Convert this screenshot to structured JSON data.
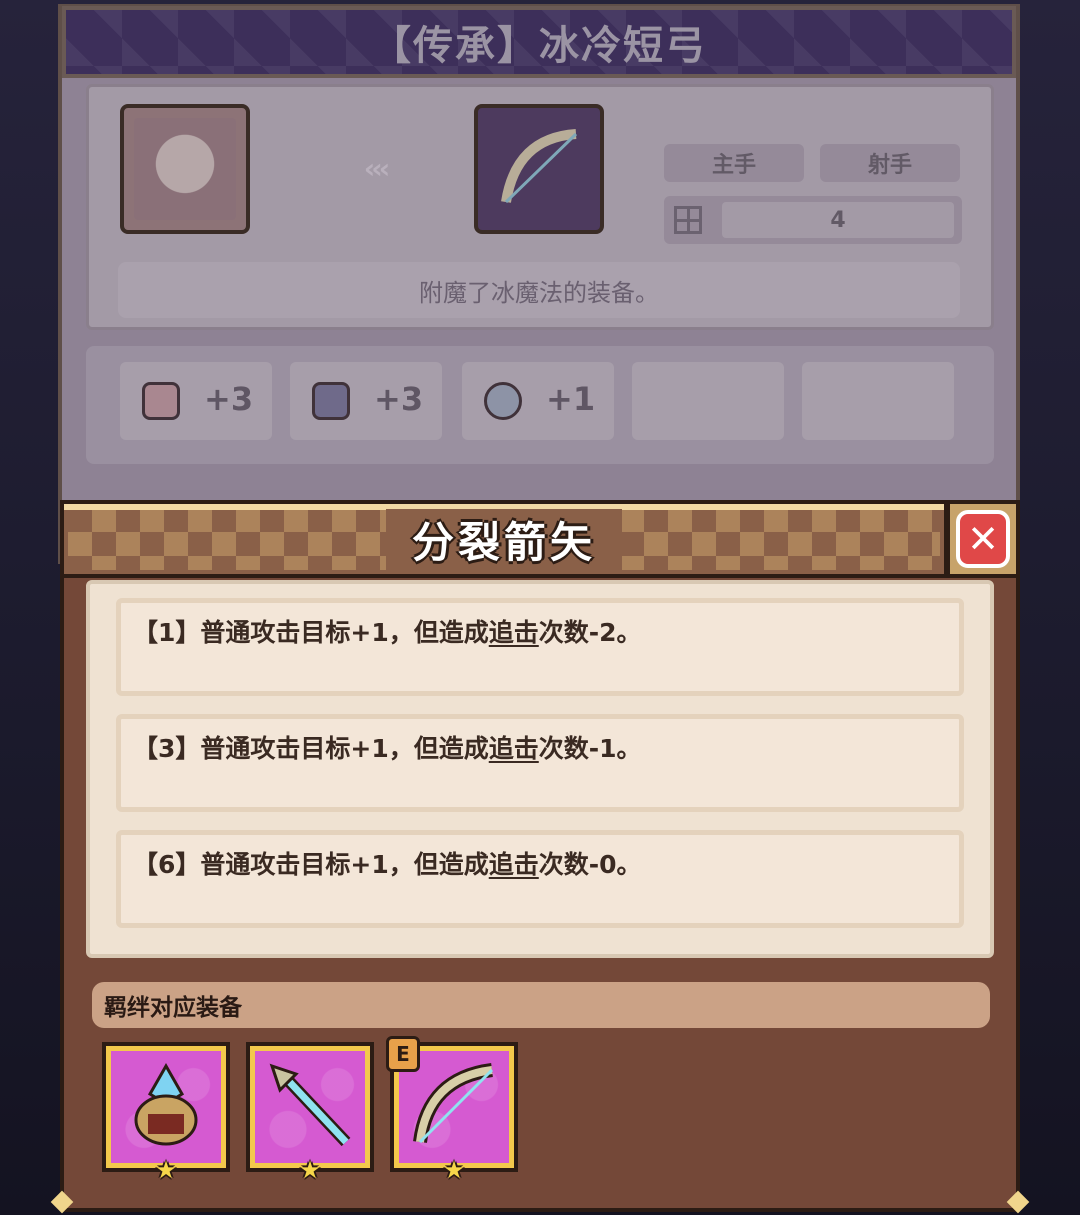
{
  "equipment": {
    "title": "【传承】冰冷短弓",
    "slot_label": "主手",
    "class_label": "射手",
    "slot_count": "4",
    "description": "附魔了冰魔法的装备。",
    "stats": [
      {
        "icon": "pink-crystal-icon",
        "value": "+3"
      },
      {
        "icon": "boot-icon",
        "value": "+3"
      },
      {
        "icon": "silver-ore-icon",
        "value": "+1"
      }
    ]
  },
  "popup": {
    "title": "分裂箭矢",
    "effects": [
      {
        "prefix": "【1】普通攻击目标+1，但造成",
        "link": "追击",
        "suffix": "次数-2。"
      },
      {
        "prefix": "【3】普通攻击目标+1，但造成",
        "link": "追击",
        "suffix": "次数-1。"
      },
      {
        "prefix": "【6】普通攻击目标+1，但造成",
        "link": "追击",
        "suffix": "次数-0。"
      }
    ],
    "bond_label": "羁绊对应装备",
    "bond_items": [
      {
        "icon": "crystal-helmet-icon",
        "stars": "★"
      },
      {
        "icon": "ice-spear-icon",
        "stars": "★"
      },
      {
        "icon": "bow-icon",
        "stars": "★",
        "badge": "E"
      }
    ]
  },
  "colors": {
    "popup_bg": "#744838",
    "panel_bg": "#efe2d2",
    "item_bg": "#d55ad1",
    "close_red": "#e04848"
  }
}
